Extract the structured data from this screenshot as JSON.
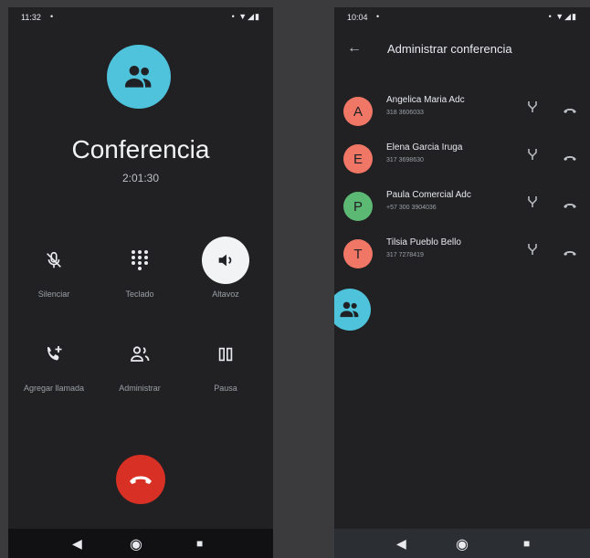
{
  "left_screen": {
    "status": {
      "time": "11:32",
      "dot": "•",
      "icons": "• ▼◢▮"
    },
    "title": "Conferencia",
    "timer": "2:01:30",
    "controls": [
      {
        "label": "Silenciar",
        "icon": "mic-off-icon"
      },
      {
        "label": "Teclado",
        "icon": "dialpad-icon"
      },
      {
        "label": "Altavoz",
        "icon": "speaker-icon",
        "active": true
      },
      {
        "label": "Agregar llamada",
        "icon": "add-call-icon"
      },
      {
        "label": "Administrar",
        "icon": "manage-people-icon"
      },
      {
        "label": "Pausa",
        "icon": "pause-icon"
      }
    ],
    "nav": {
      "back": "◀",
      "home": "◉",
      "recents": "■"
    }
  },
  "right_screen": {
    "status": {
      "time": "10:04",
      "dot": "•",
      "icons": "• ▼◢▮"
    },
    "app_title": "Administrar conferencia",
    "back_glyph": "←",
    "participants": [
      {
        "initial": "A",
        "name": "Angelica Maria Adc",
        "number": "318 3606033",
        "color": "#f07766"
      },
      {
        "initial": "E",
        "name": "Elena Garcia Iruga",
        "number": "317 3698630",
        "color": "#f07766"
      },
      {
        "initial": "P",
        "name": "Paula Comercial Adc",
        "number": "+57 300 3904036",
        "color": "#5bb974"
      },
      {
        "initial": "T",
        "name": "Tilsia Pueblo Bello",
        "number": "317 7278419",
        "color": "#f07766"
      }
    ],
    "nav": {
      "back": "◀",
      "home": "◉",
      "recents": "■"
    }
  },
  "colors": {
    "accent": "#4fc3dc",
    "end_call": "#d93025",
    "background": "#212124"
  }
}
